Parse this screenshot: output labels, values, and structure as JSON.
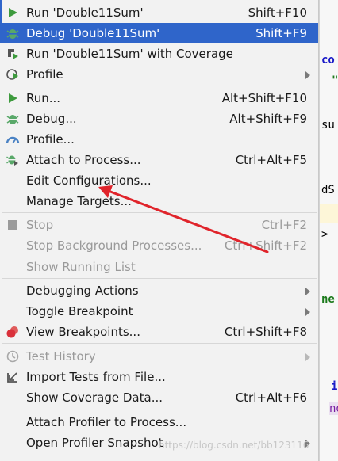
{
  "editor_fragments": [
    "co",
    "\"",
    "su",
    "dS",
    ">",
    "ne",
    "i",
    "no"
  ],
  "menu": [
    {
      "label": "Run 'Double11Sum'",
      "shortcut": "Shift+F10",
      "icon": "run-icon"
    },
    {
      "label": "Debug 'Double11Sum'",
      "shortcut": "Shift+F9",
      "icon": "debug-icon"
    },
    {
      "label": "Run 'Double11Sum' with Coverage",
      "shortcut": "",
      "icon": "coverage-icon"
    },
    {
      "label": "Profile",
      "shortcut": "",
      "icon": "profile-icon"
    },
    {
      "label": "Run...",
      "shortcut": "Alt+Shift+F10",
      "icon": "run-icon"
    },
    {
      "label": "Debug...",
      "shortcut": "Alt+Shift+F9",
      "icon": "debug-icon"
    },
    {
      "label": "Profile...",
      "shortcut": "",
      "icon": "profiler-gauge-icon"
    },
    {
      "label": "Attach to Process...",
      "shortcut": "Ctrl+Alt+F5",
      "icon": "attach-debugger-icon"
    },
    {
      "label": "Edit Configurations...",
      "shortcut": "",
      "icon": ""
    },
    {
      "label": "Manage Targets...",
      "shortcut": "",
      "icon": ""
    },
    {
      "label": "Stop",
      "shortcut": "Ctrl+F2",
      "icon": "stop-icon"
    },
    {
      "label": "Stop Background Processes...",
      "shortcut": "Ctrl+Shift+F2",
      "icon": ""
    },
    {
      "label": "Show Running List",
      "shortcut": "",
      "icon": ""
    },
    {
      "label": "Debugging Actions",
      "shortcut": "",
      "icon": ""
    },
    {
      "label": "Toggle Breakpoint",
      "shortcut": "",
      "icon": ""
    },
    {
      "label": "View Breakpoints...",
      "shortcut": "Ctrl+Shift+F8",
      "icon": "breakpoints-icon"
    },
    {
      "label": "Test History",
      "shortcut": "",
      "icon": "test-history-icon"
    },
    {
      "label": "Import Tests from File...",
      "shortcut": "",
      "icon": "import-tests-icon"
    },
    {
      "label": "Show Coverage Data...",
      "shortcut": "Ctrl+Alt+F6",
      "icon": ""
    },
    {
      "label": "Attach Profiler to Process...",
      "shortcut": "",
      "icon": ""
    },
    {
      "label": "Open Profiler Snapshot",
      "shortcut": "",
      "icon": ""
    }
  ],
  "watermark": "https://blog.csdn.net/bb123116",
  "colors": {
    "selection": "#2f65ca",
    "menu_bg": "#f2f2f2",
    "arrow": "#e0242b",
    "run_green": "#3d9a3d",
    "debug_green": "#59a869",
    "stop_gray": "#9b9b9b"
  }
}
